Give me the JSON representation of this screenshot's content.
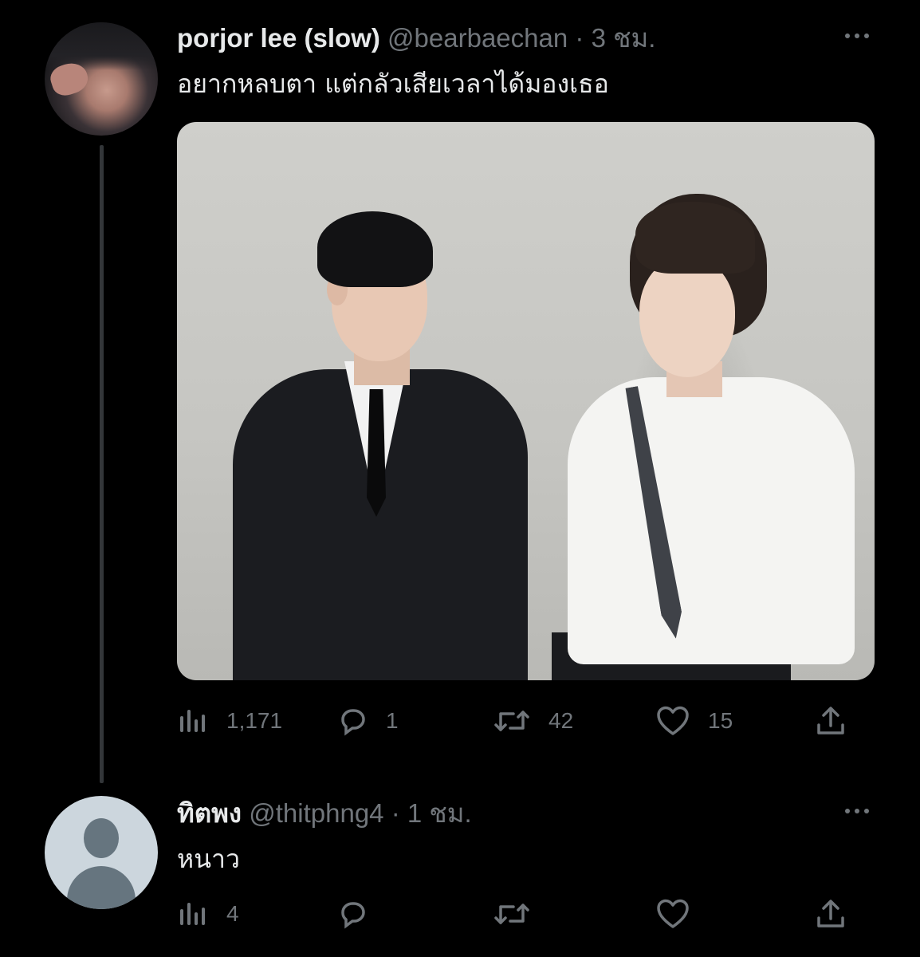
{
  "tweet": {
    "display_name": "porjor lee (slow)",
    "handle": "@bearbaechan",
    "separator": "·",
    "time": "3 ชม.",
    "text": "อยากหลบตา แต่กลัวเสียเวลาได้มองเธอ",
    "actions": {
      "views": "1,171",
      "replies": "1",
      "retweets": "42",
      "likes": "15"
    }
  },
  "reply": {
    "display_name": "ทิตพง",
    "handle": "@thitphng4",
    "separator": "·",
    "time": "1 ชม.",
    "text": "หนาว",
    "actions": {
      "views": "4",
      "replies": "",
      "retweets": "",
      "likes": ""
    }
  },
  "colors": {
    "background": "#000000",
    "text_primary": "#e7e9ea",
    "text_secondary": "#71767b",
    "thread_line": "#333639"
  },
  "icons": [
    "more-icon",
    "views-icon",
    "reply-icon",
    "retweet-icon",
    "like-icon",
    "share-icon"
  ]
}
